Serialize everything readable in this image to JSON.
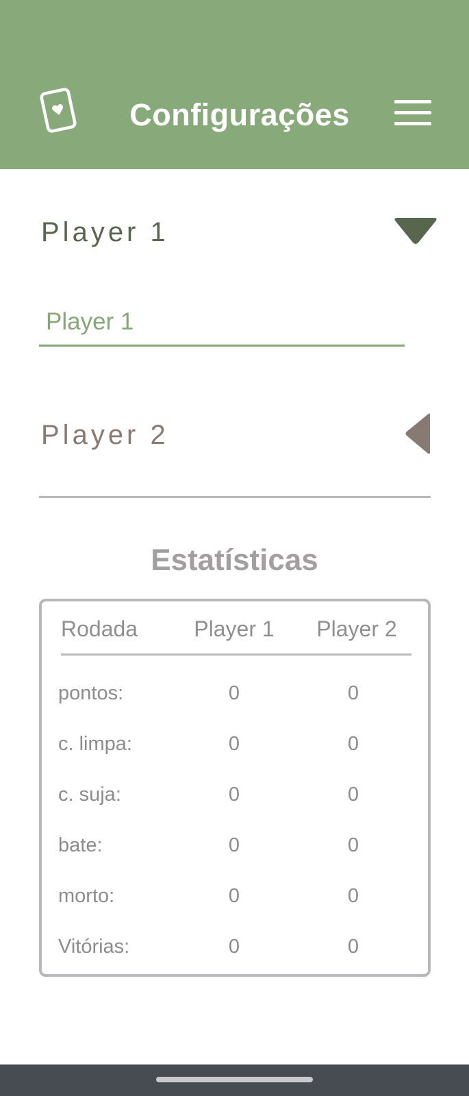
{
  "header": {
    "title": "Configurações",
    "icon": "card-heart-icon",
    "menu_icon": "hamburger-menu-icon",
    "background": "#88aa7a"
  },
  "players": [
    {
      "title": "Player 1",
      "expanded": true,
      "toggle_icon": "triangle-down-icon",
      "name_value": "Player 1",
      "name_placeholder": "Player 1"
    },
    {
      "title": "Player 2",
      "expanded": false,
      "toggle_icon": "triangle-left-icon"
    }
  ],
  "stats": {
    "title": "Estatísticas",
    "headers": [
      "Rodada",
      "Player 1",
      "Player 2"
    ],
    "rows": [
      {
        "label": "pontos:",
        "p1": "0",
        "p2": "0"
      },
      {
        "label": "c. limpa:",
        "p1": "0",
        "p2": "0"
      },
      {
        "label": "c. suja:",
        "p1": "0",
        "p2": "0"
      },
      {
        "label": "bate:",
        "p1": "0",
        "p2": "0"
      },
      {
        "label": "morto:",
        "p1": "0",
        "p2": "0"
      },
      {
        "label": "Vitórias:",
        "p1": "0",
        "p2": "0"
      }
    ]
  },
  "colors": {
    "accent_green": "#86a778",
    "player1_text": "#58664e",
    "player2_text": "#877a72",
    "muted_text": "#8c8c8c",
    "nav_bar": "#474c53"
  }
}
